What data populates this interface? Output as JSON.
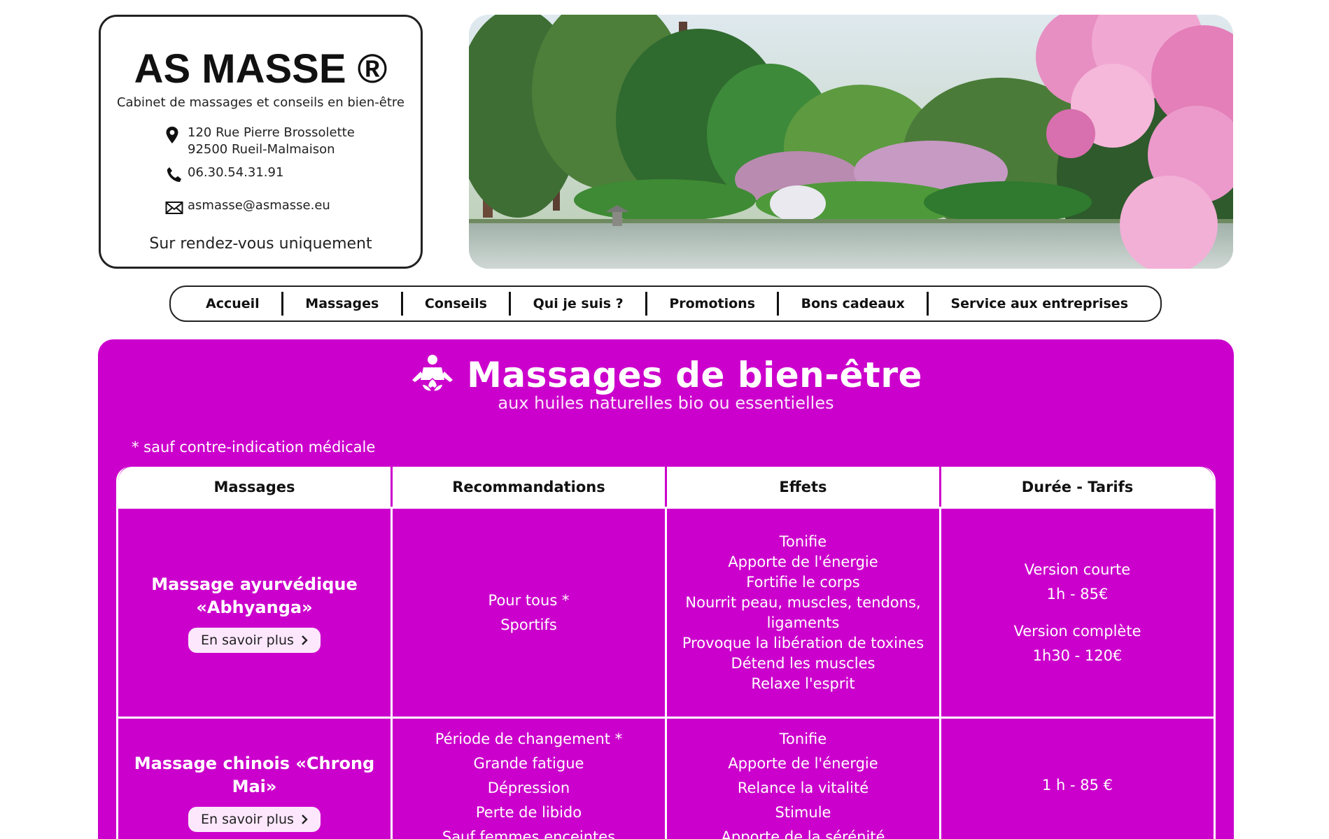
{
  "header": {
    "brand": "AS MASSE ®",
    "tagline": "Cabinet de massages et conseils en bien-être",
    "address_line1": "120 Rue Pierre Brossolette",
    "address_line2": "92500 Rueil-Malmaison",
    "phone": "06.30.54.31.91",
    "email": "asmasse@asmasse.eu",
    "appointment": "Sur rendez-vous uniquement"
  },
  "nav": {
    "items": [
      "Accueil",
      "Massages",
      "Conseils",
      "Qui je suis ?",
      "Promotions",
      "Bons cadeaux",
      "Service aux entreprises"
    ]
  },
  "main": {
    "title": "Massages de bien-être",
    "subtitle": "aux huiles naturelles bio ou essentielles",
    "note": "* sauf contre-indication médicale",
    "columns": [
      "Massages",
      "Recommandations",
      "Effets",
      "Durée - Tarifs"
    ],
    "more_label": "En savoir plus",
    "rows": [
      {
        "name_line1": "Massage ayurvédique",
        "name_line2": "«Abhyanga»",
        "recommendations": [
          "Pour tous *",
          "Sportifs"
        ],
        "effects": [
          "Tonifie",
          "Apporte de l'énergie",
          "Fortifie le corps",
          "Nourrit peau, muscles, tendons,",
          "ligaments",
          "Provoque la libération de toxines",
          "Détend les muscles",
          "Relaxe l'esprit"
        ],
        "prices": [
          "Version courte",
          "1h - 85€",
          "Version complète",
          "1h30 - 120€"
        ]
      },
      {
        "name_line1": "Massage chinois «Chrong Mai»",
        "recommendations": [
          "Période de changement *",
          "Grande fatigue",
          "Dépression",
          "Perte de libido",
          "Sauf femmes enceintes"
        ],
        "effects": [
          "Tonifie",
          "Apporte de l'énergie",
          "Relance la vitalité",
          "Stimule",
          "Apporte de la sérénité"
        ],
        "prices": [
          "1 h - 85 €"
        ]
      }
    ]
  },
  "colors": {
    "accent": "#cc00cc",
    "button_bg": "#fde7fd",
    "text_dark": "#111111"
  },
  "icons": {
    "address": "map-pin-icon",
    "phone": "phone-icon",
    "email": "envelope-icon",
    "title": "lotus-meditation-icon",
    "more": "chevron-right-icon"
  }
}
